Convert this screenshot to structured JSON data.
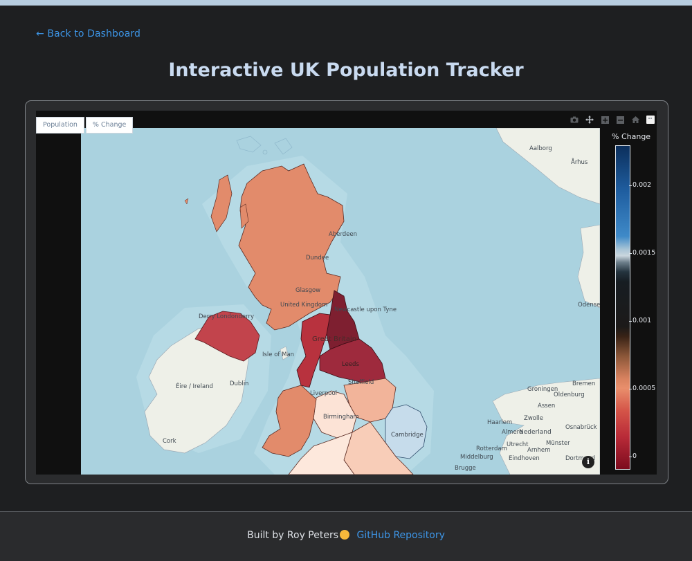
{
  "nav": {
    "back_label": "← Back to Dashboard"
  },
  "page": {
    "title": "Interactive UK Population Tracker"
  },
  "map_controls": {
    "buttons": [
      "Population",
      "% Change"
    ]
  },
  "map": {
    "labels": {
      "united_kingdom": "United Kingdom",
      "great_britain": "Great Britain",
      "glasgow": "Glasgow",
      "dundee": "Dundee",
      "aberdeen": "Aberdeen",
      "newcastle": "Newcastle upon Tyne",
      "leeds": "Leeds",
      "sheffield": "Sheffield",
      "liverpool": "Liverpool",
      "birmingham": "Birmingham",
      "cambridge": "Cambridge",
      "isle_of_man": "Isle of Man",
      "derry": "Derry Londonderry",
      "dublin": "Dublin",
      "eire": "Éire / Ireland",
      "cork": "Cork",
      "nederland": "Nederland",
      "groningen": "Groningen",
      "bremen": "Bremen",
      "haarlem": "Haarlem",
      "utrecht": "Utrecht",
      "zwolle": "Zwolle",
      "munster": "Münster",
      "osnabruck": "Osnabrück",
      "eindhoven": "Eindhoven",
      "middelburg": "Middelburg",
      "brugge": "Brugge",
      "rotterdam": "Rotterdam",
      "aalborg": "Aalborg",
      "arhus": "Århus",
      "odense": "Odense",
      "assen": "Assen",
      "oldenburg": "Oldenburg",
      "almere": "Almere",
      "arnhem": "Arnhem",
      "dortmund": "Dortmund"
    },
    "info_label": "i"
  },
  "colorbar": {
    "title": "% Change",
    "ticks": [
      "0.002",
      "0.0015",
      "0.001",
      "0.0005",
      "0"
    ],
    "colorscale": [
      "#0c2f5c",
      "#3f8ac8",
      "#cad6de",
      "#24343f",
      "#1c1a19",
      "#8a5638",
      "#e98f6c",
      "#b92b38",
      "#7c0b1e"
    ]
  },
  "footer": {
    "built_by": "Built by Roy Peters",
    "repo_link": "GitHub Repository"
  },
  "colors": {
    "accent": "#3d95e6",
    "title": "#c9daf0",
    "background": "#1e1f21"
  }
}
